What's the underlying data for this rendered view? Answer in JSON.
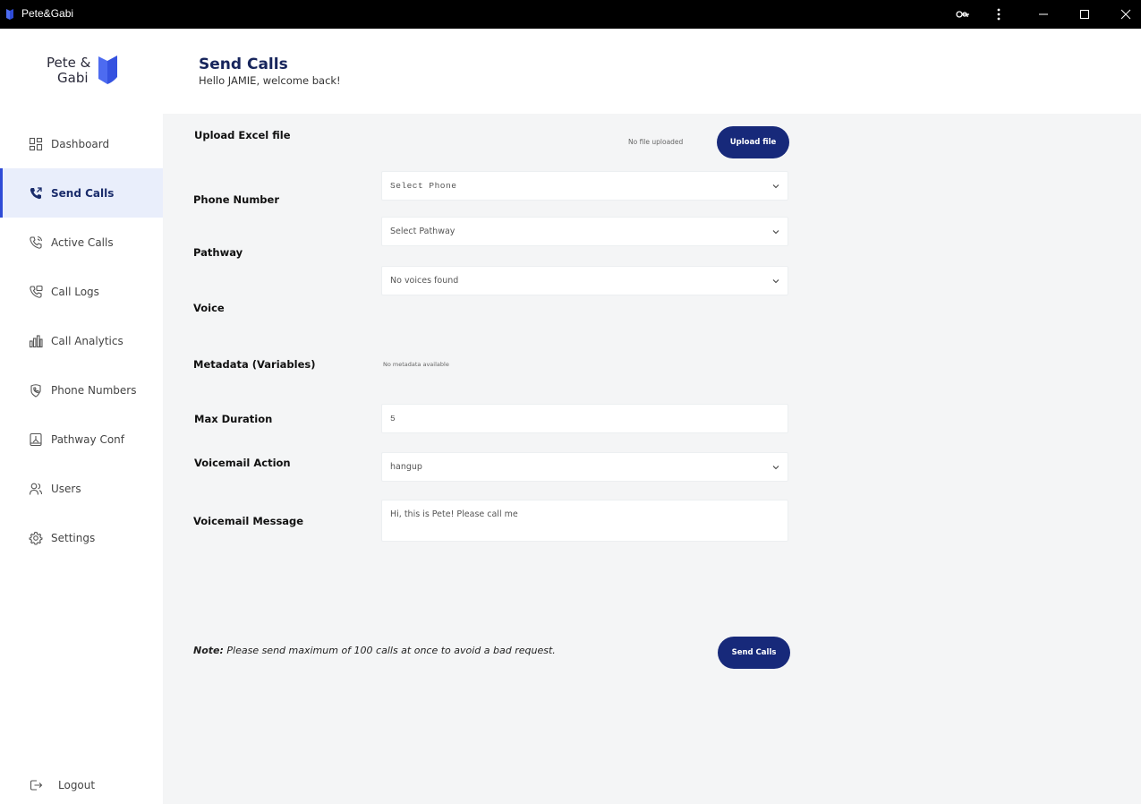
{
  "window": {
    "title": "Pete&Gabi"
  },
  "logo": {
    "line1": "Pete &",
    "line2": "Gabi",
    "brand_color": "#4d6bf0"
  },
  "header": {
    "title": "Send Calls",
    "subtitle": "Hello JAMIE, welcome back!"
  },
  "sidebar": {
    "items": [
      {
        "label": "Dashboard",
        "icon": "dashboard-icon"
      },
      {
        "label": "Send Calls",
        "icon": "phone-outgoing-icon",
        "active": true
      },
      {
        "label": "Active Calls",
        "icon": "phone-active-icon"
      },
      {
        "label": "Call Logs",
        "icon": "phone-log-icon"
      },
      {
        "label": "Call Analytics",
        "icon": "bar-chart-icon"
      },
      {
        "label": "Phone Numbers",
        "icon": "phone-number-icon"
      },
      {
        "label": "Pathway Conf",
        "icon": "pathway-icon"
      },
      {
        "label": "Users",
        "icon": "users-icon"
      },
      {
        "label": "Settings",
        "icon": "gear-icon"
      }
    ],
    "logout": "Logout"
  },
  "form": {
    "upload_label": "Upload Excel file",
    "upload_status": "No file uploaded",
    "upload_button": "Upload file",
    "phone_label": "Phone Number",
    "phone_value": "Select Phone",
    "pathway_label": "Pathway",
    "pathway_value": "Select Pathway",
    "voice_label": "Voice",
    "voice_value": "No voices found",
    "metadata_label": "Metadata (Variables)",
    "metadata_value": "No metadata available",
    "max_duration_label": "Max Duration",
    "max_duration_value": "5",
    "voicemail_action_label": "Voicemail Action",
    "voicemail_action_value": "hangup",
    "voicemail_message_label": "Voicemail Message",
    "voicemail_message_value": "Hi, this is Pete! Please call me",
    "note_prefix": "Note:",
    "note_text": " Please send maximum of 100 calls at once to avoid a bad request.",
    "send_button": "Send Calls"
  },
  "colors": {
    "primary": "#17297a",
    "active_bg": "#e9eefb",
    "active_bar": "#2e4bd6",
    "content_bg": "#f4f5f6"
  }
}
